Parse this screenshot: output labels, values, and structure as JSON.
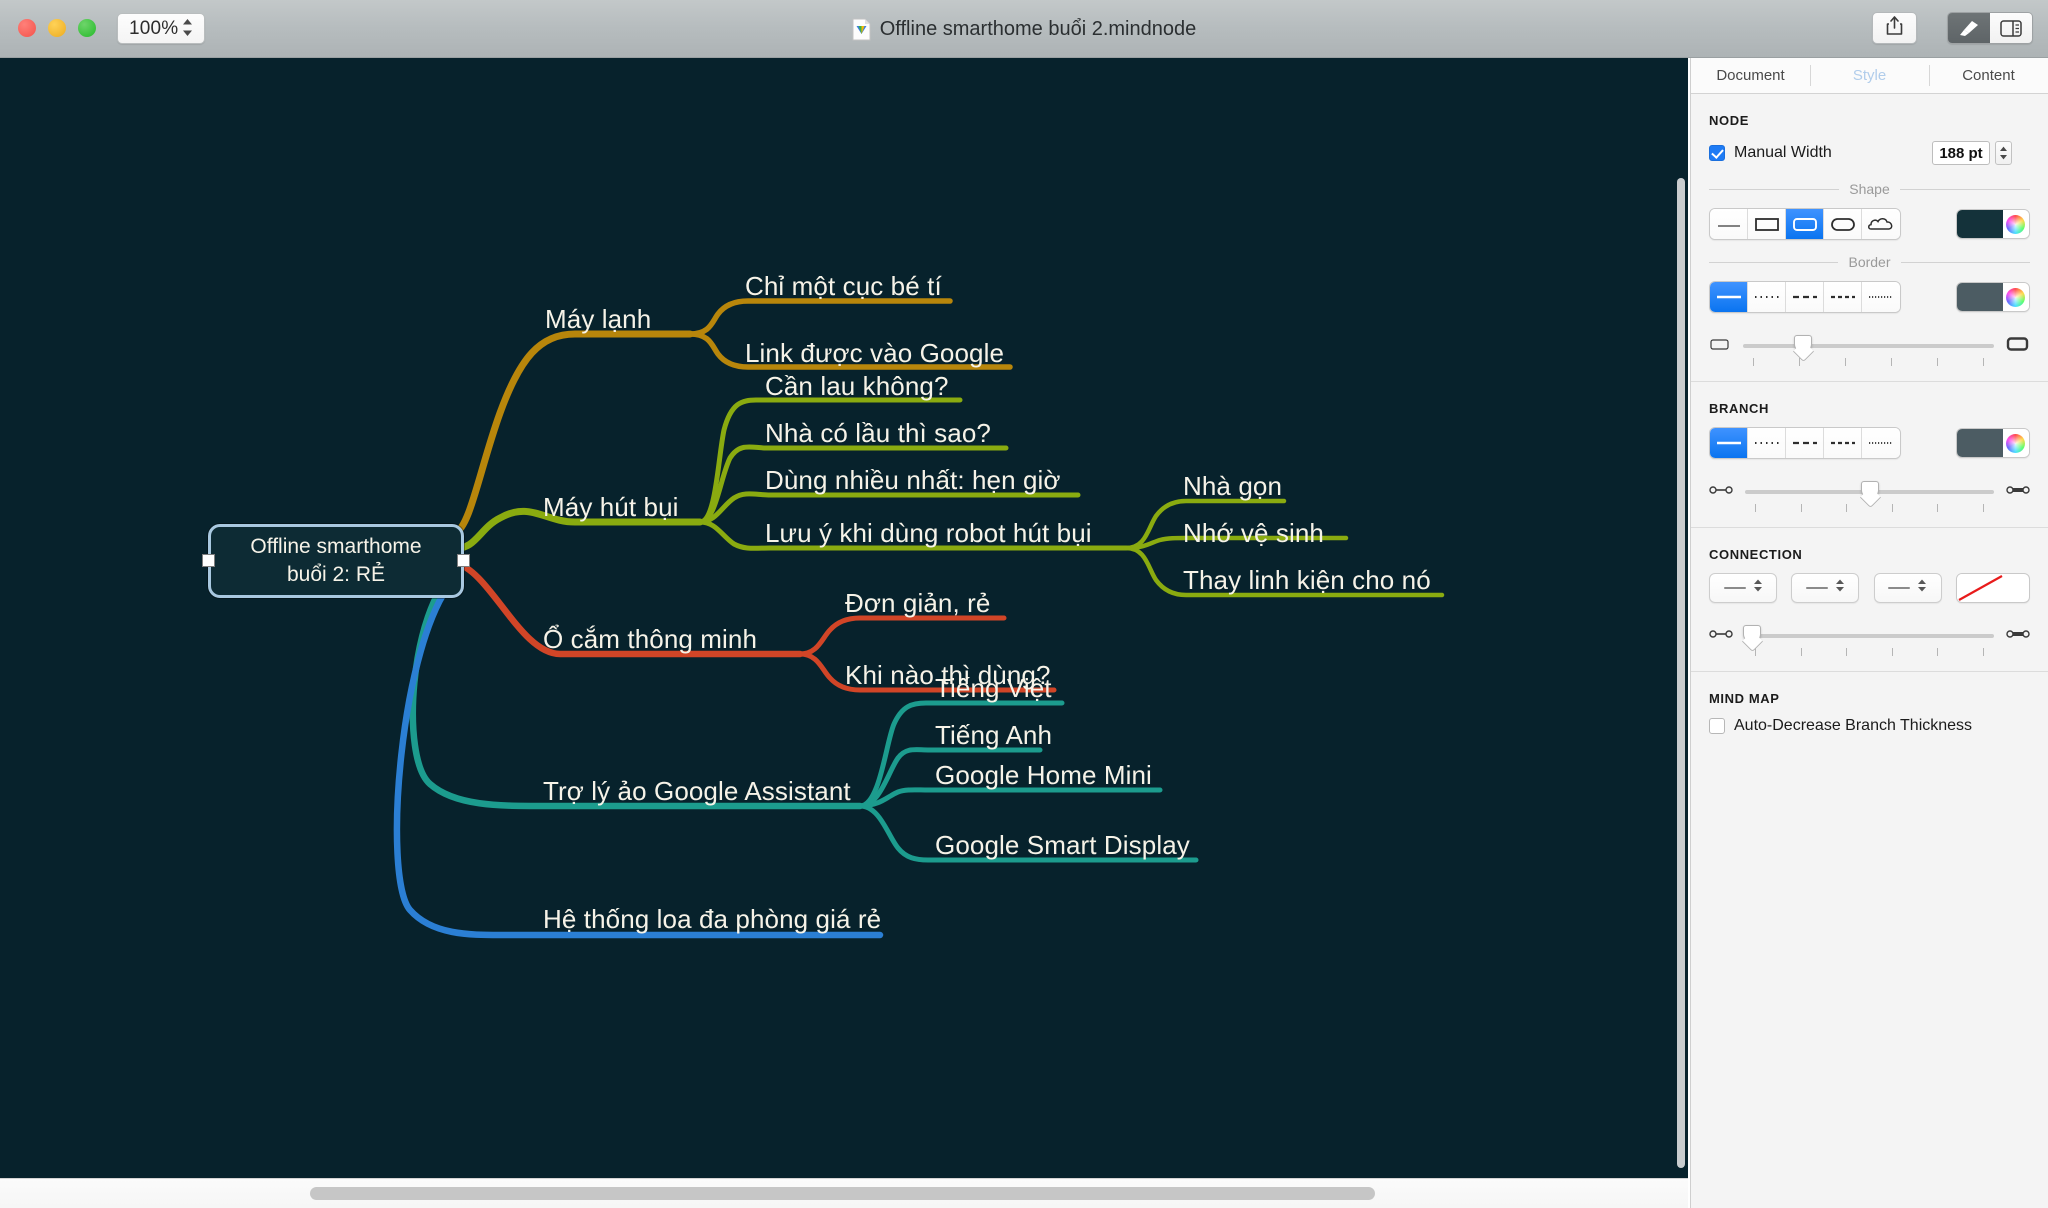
{
  "window": {
    "title": "Offline smarthome buổi 2.mindnode",
    "zoom_value": "100%",
    "traffic_lights": [
      "close",
      "minimize",
      "maximize"
    ]
  },
  "toolbar": {
    "share_label": "share-icon",
    "style_toggle_label": "paintbrush-icon",
    "inspector_toggle_label": "inspector-icon"
  },
  "mindmap": {
    "background_color": "#07222c",
    "central": {
      "line1": "Offline smarthome",
      "line2": "buổi 2: RẺ",
      "selected": true,
      "border_color": "#a8c8e0",
      "fill_color": "#0d2b34"
    },
    "branches": [
      {
        "label": "Máy lạnh",
        "color": "#b8860b",
        "children": [
          {
            "label": "Chỉ một cục bé tí"
          },
          {
            "label": "Link được vào Google"
          }
        ]
      },
      {
        "label": "Máy hút bụi",
        "color": "#8aab10",
        "children": [
          {
            "label": "Cần lau không?"
          },
          {
            "label": "Nhà có lầu thì sao?"
          },
          {
            "label": "Dùng nhiều nhất: hẹn giờ"
          },
          {
            "label": "Lưu ý khi dùng robot hút bụi",
            "children": [
              {
                "label": "Nhà gọn"
              },
              {
                "label": "Nhớ vệ sinh"
              },
              {
                "label": "Thay linh kiện cho nó"
              }
            ]
          }
        ]
      },
      {
        "label": "Ổ cắm thông minh",
        "color": "#d14527",
        "children": [
          {
            "label": "Đơn giản, rẻ"
          },
          {
            "label": "Khi nào thì dùng?"
          }
        ]
      },
      {
        "label": "Trợ lý ảo Google Assistant",
        "color": "#1c9c8e",
        "children": [
          {
            "label": "Tiếng Việt"
          },
          {
            "label": "Tiếng Anh"
          },
          {
            "label": "Google Home Mini"
          },
          {
            "label": "Google Smart Display"
          }
        ]
      },
      {
        "label": "Hệ thống loa đa phòng giá rẻ",
        "color": "#2b7fd4",
        "children": []
      }
    ]
  },
  "inspector": {
    "tabs": [
      {
        "label": "Document",
        "active": false
      },
      {
        "label": "Style",
        "active": true
      },
      {
        "label": "Content",
        "active": false
      }
    ],
    "node": {
      "title": "NODE",
      "manual_width_label": "Manual Width",
      "manual_width_checked": true,
      "width_value": "188 pt",
      "shape_legend": "Shape",
      "shape_options": [
        "underline",
        "rect-outline",
        "rect-filled",
        "pill",
        "cloud"
      ],
      "shape_selected_index": 2,
      "shape_fill_color": "#14323a",
      "border_legend": "Border",
      "border_options": [
        "solid",
        "dotted",
        "dashed-long",
        "dashed-med",
        "dotted-fine"
      ],
      "border_selected_index": 0,
      "border_color": "#4c5c63",
      "border_width_slider": 24
    },
    "branch": {
      "title": "BRANCH",
      "style_options": [
        "solid",
        "dotted",
        "dashed-long",
        "dashed-med",
        "dotted-fine"
      ],
      "style_selected_index": 0,
      "color": "#4c5c63",
      "thickness_slider": 50
    },
    "connection": {
      "title": "CONNECTION",
      "steppers": [
        "line-start",
        "line-style",
        "line-end"
      ],
      "preview_color": "#e81b1b",
      "thickness_slider": 3
    },
    "mindmap_section": {
      "title": "MIND MAP",
      "auto_decrease_label": "Auto-Decrease Branch Thickness",
      "auto_decrease_checked": false
    }
  }
}
